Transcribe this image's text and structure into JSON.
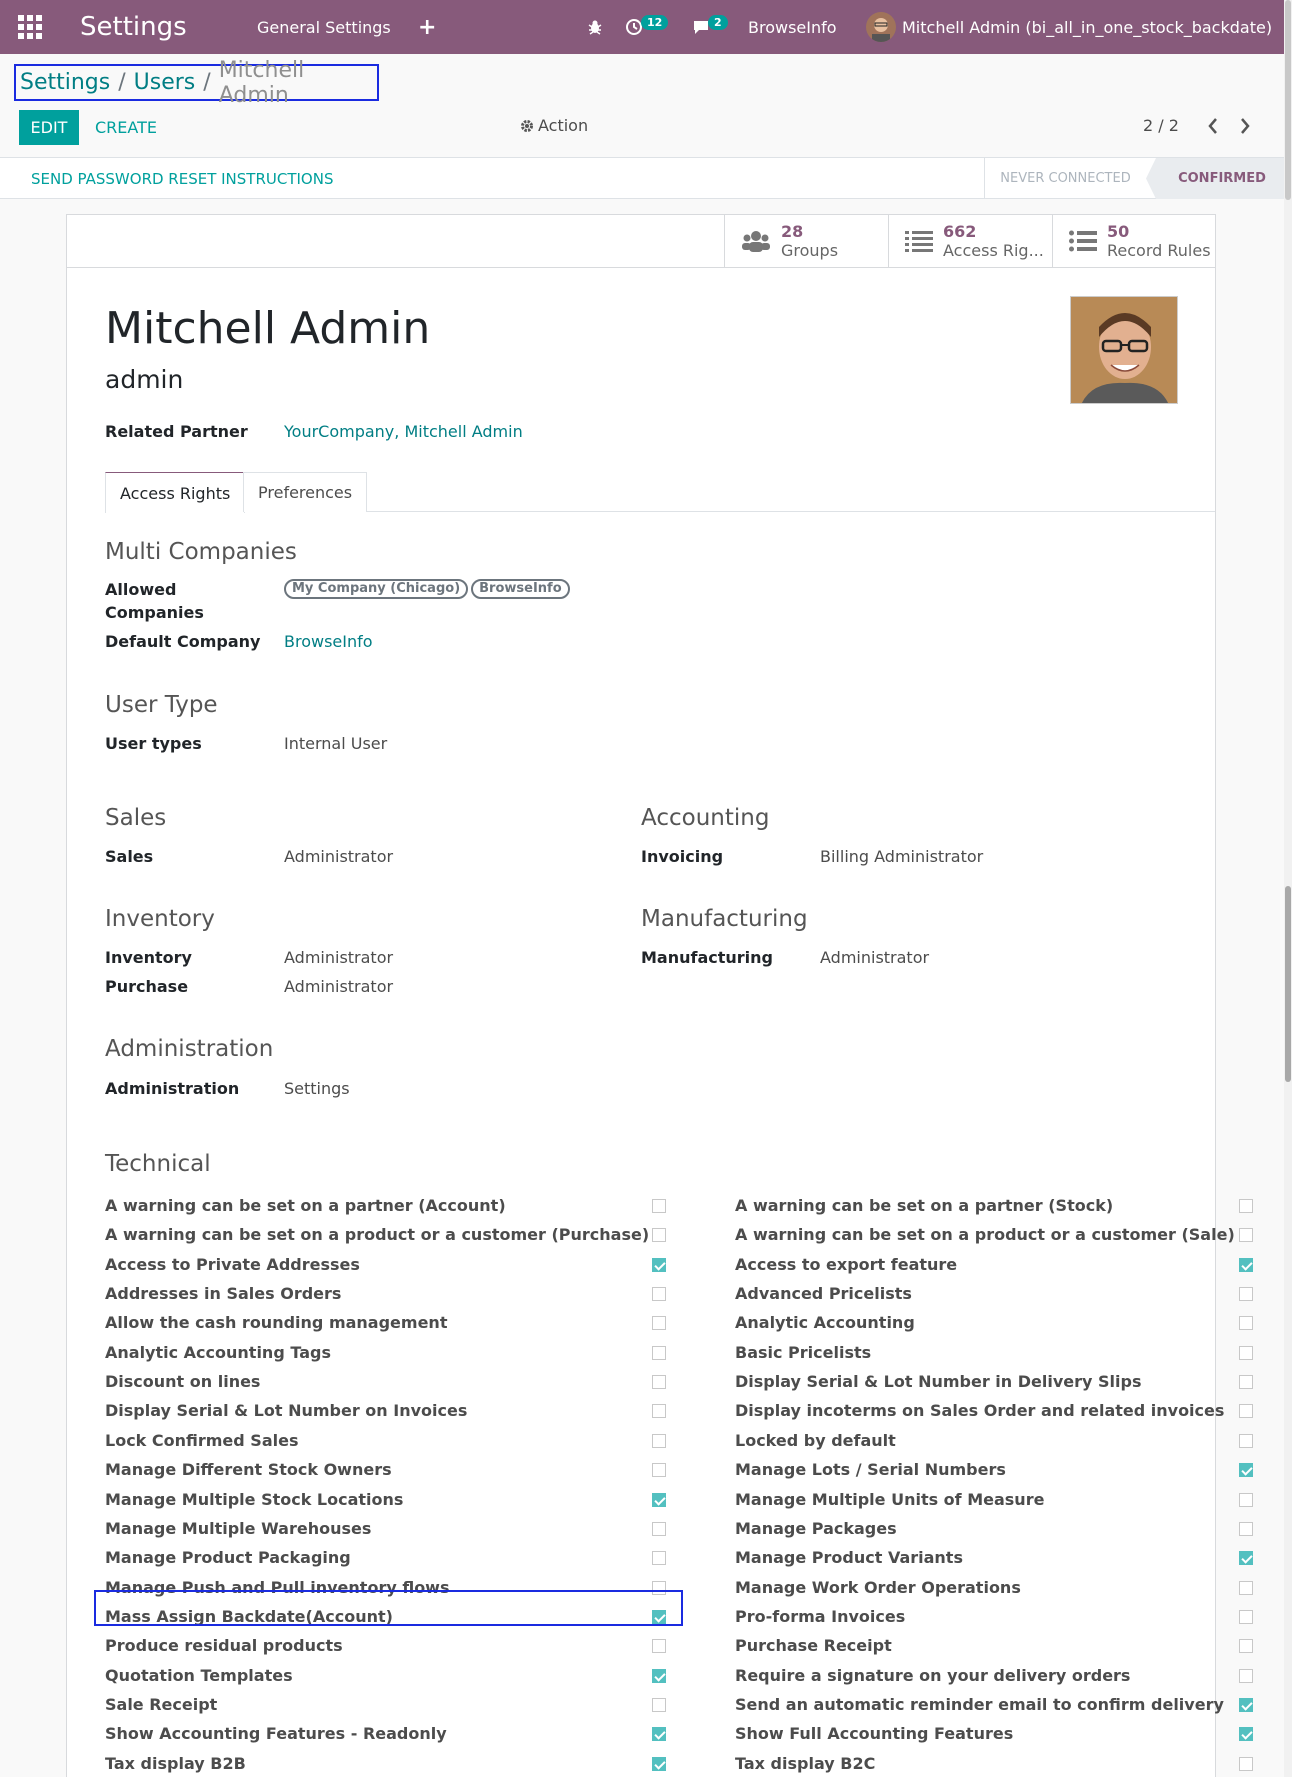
{
  "navbar": {
    "app_title": "Settings",
    "menu_general": "General Settings",
    "add_symbol": "+",
    "activity_count": "12",
    "message_count": "2",
    "company": "BrowseInfo",
    "user": "Mitchell Admin (bi_all_in_one_stock_backdate)"
  },
  "breadcrumb": {
    "root": "Settings",
    "parent": "Users",
    "current": "Mitchell Admin",
    "separator": "/"
  },
  "controls": {
    "edit": "EDIT",
    "create": "CREATE",
    "action": "Action",
    "pager": "2 / 2"
  },
  "statusbar": {
    "reset": "SEND PASSWORD RESET INSTRUCTIONS",
    "never_connected": "NEVER CONNECTED",
    "confirmed": "CONFIRMED"
  },
  "smart_buttons": [
    {
      "count": "28",
      "label": "Groups"
    },
    {
      "count": "662",
      "label": "Access Rig..."
    },
    {
      "count": "50",
      "label": "Record Rules"
    }
  ],
  "user": {
    "name": "Mitchell Admin",
    "login": "admin",
    "related_partner_label": "Related Partner",
    "related_partner": "YourCompany, Mitchell Admin"
  },
  "tabs": {
    "access_rights": "Access Rights",
    "preferences": "Preferences"
  },
  "multi_companies": {
    "title": "Multi Companies",
    "allowed_label_1": "Allowed",
    "allowed_label_2": "Companies",
    "allowed": [
      "My Company (Chicago)",
      "BrowseInfo"
    ],
    "default_label": "Default Company",
    "default": "BrowseInfo"
  },
  "user_type": {
    "title": "User Type",
    "label": "User types",
    "value": "Internal User"
  },
  "sales": {
    "title": "Sales",
    "label": "Sales",
    "value": "Administrator"
  },
  "accounting": {
    "title": "Accounting",
    "label": "Invoicing",
    "value": "Billing Administrator"
  },
  "inventory": {
    "title": "Inventory",
    "inventory_label": "Inventory",
    "inventory_value": "Administrator",
    "purchase_label": "Purchase",
    "purchase_value": "Administrator"
  },
  "manufacturing": {
    "title": "Manufacturing",
    "label": "Manufacturing",
    "value": "Administrator"
  },
  "administration": {
    "title": "Administration",
    "label": "Administration",
    "value": "Settings"
  },
  "technical": {
    "title": "Technical",
    "left": [
      {
        "label": "A warning can be set on a partner (Account)",
        "checked": false
      },
      {
        "label": "A warning can be set on a product or a customer (Purchase)",
        "checked": false
      },
      {
        "label": "Access to Private Addresses",
        "checked": true
      },
      {
        "label": "Addresses in Sales Orders",
        "checked": false
      },
      {
        "label": "Allow the cash rounding management",
        "checked": false
      },
      {
        "label": "Analytic Accounting Tags",
        "checked": false
      },
      {
        "label": "Discount on lines",
        "checked": false
      },
      {
        "label": "Display Serial & Lot Number on Invoices",
        "checked": false
      },
      {
        "label": "Lock Confirmed Sales",
        "checked": false
      },
      {
        "label": "Manage Different Stock Owners",
        "checked": false
      },
      {
        "label": "Manage Multiple Stock Locations",
        "checked": true
      },
      {
        "label": "Manage Multiple Warehouses",
        "checked": false
      },
      {
        "label": "Manage Product Packaging",
        "checked": false
      },
      {
        "label": "Manage Push and Pull inventory flows",
        "checked": false
      },
      {
        "label": "Mass Assign Backdate(Account)",
        "checked": true
      },
      {
        "label": "Produce residual products",
        "checked": false
      },
      {
        "label": "Quotation Templates",
        "checked": true
      },
      {
        "label": "Sale Receipt",
        "checked": false
      },
      {
        "label": "Show Accounting Features - Readonly",
        "checked": true
      },
      {
        "label": "Tax display B2B",
        "checked": true
      }
    ],
    "right": [
      {
        "label": "A warning can be set on a partner (Stock)",
        "checked": false
      },
      {
        "label": "A warning can be set on a product or a customer (Sale)",
        "checked": false
      },
      {
        "label": "Access to export feature",
        "checked": true
      },
      {
        "label": "Advanced Pricelists",
        "checked": false
      },
      {
        "label": "Analytic Accounting",
        "checked": false
      },
      {
        "label": "Basic Pricelists",
        "checked": false
      },
      {
        "label": "Display Serial & Lot Number in Delivery Slips",
        "checked": false
      },
      {
        "label": "Display incoterms on Sales Order and related invoices",
        "checked": false
      },
      {
        "label": "Locked by default",
        "checked": false
      },
      {
        "label": "Manage Lots / Serial Numbers",
        "checked": true
      },
      {
        "label": "Manage Multiple Units of Measure",
        "checked": false
      },
      {
        "label": "Manage Packages",
        "checked": false
      },
      {
        "label": "Manage Product Variants",
        "checked": true
      },
      {
        "label": "Manage Work Order Operations",
        "checked": false
      },
      {
        "label": "Pro-forma Invoices",
        "checked": false
      },
      {
        "label": "Purchase Receipt",
        "checked": false
      },
      {
        "label": "Require a signature on your delivery orders",
        "checked": false
      },
      {
        "label": "Send an automatic reminder email to confirm delivery",
        "checked": true
      },
      {
        "label": "Show Full Accounting Features",
        "checked": true
      },
      {
        "label": "Tax display B2C",
        "checked": false
      }
    ]
  }
}
